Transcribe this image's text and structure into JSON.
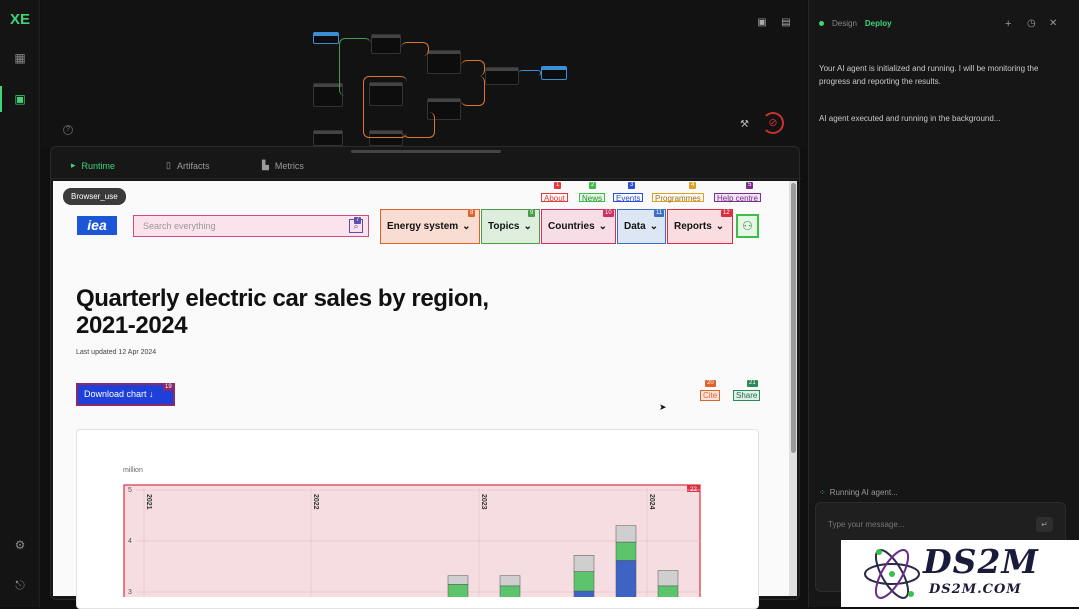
{
  "sidebar": {
    "logo": "XE",
    "icons": [
      "grid-icon",
      "board-icon",
      "settings-icon",
      "logout-icon"
    ]
  },
  "runtime_tabs": [
    {
      "label": "Runtime",
      "icon": "terminal-icon"
    },
    {
      "label": "Artifacts",
      "icon": "file-icon"
    },
    {
      "label": "Metrics",
      "icon": "chart-icon"
    }
  ],
  "browser": {
    "badge": "Browser_use",
    "top_links": [
      {
        "label": "About",
        "tag": "1",
        "color": "#e23b3b"
      },
      {
        "label": "News",
        "tag": "2",
        "color": "#3bbf4a"
      },
      {
        "label": "Events",
        "tag": "3",
        "color": "#2a4fd6"
      },
      {
        "label": "Programmes",
        "tag": "4",
        "color": "#e0a020"
      },
      {
        "label": "Help centre",
        "tag": "5",
        "color": "#7a2f8a"
      }
    ],
    "logo_text": "iea",
    "search_placeholder": "Search everything",
    "search_tag": "7",
    "nav": [
      {
        "label": "Energy system",
        "tag": "8",
        "bg": "#f9dcd2",
        "border": "#e0622c",
        "tagcolor": "#e0622c"
      },
      {
        "label": "Topics",
        "tag": "9",
        "bg": "#ddeedd",
        "border": "#4a9a4a",
        "tagcolor": "#4a9a4a"
      },
      {
        "label": "Countries",
        "tag": "10",
        "bg": "#f7dde5",
        "border": "#d03060",
        "tagcolor": "#d03060"
      },
      {
        "label": "Data",
        "tag": "11",
        "bg": "#dde6f5",
        "border": "#3a6fc4",
        "tagcolor": "#3a6fc4"
      },
      {
        "label": "Reports",
        "tag": "12",
        "bg": "#f9dde0",
        "border": "#d83040",
        "tagcolor": "#d83040"
      }
    ],
    "headline": "Quarterly electric car sales by region, 2021-2024",
    "updated": "Last updated 12 Apr 2024",
    "download_label": "Download chart ↓",
    "download_tag": "19",
    "cite_label": "Cite",
    "cite_tag": "20",
    "share_label": "Share",
    "share_tag": "21"
  },
  "chart_data": {
    "type": "bar",
    "stacked": true,
    "ylabel": "million",
    "ylim": [
      3,
      5
    ],
    "yticks": [
      3,
      4,
      5
    ],
    "year_labels": [
      "2021",
      "2022",
      "2023",
      "2024"
    ],
    "highlight_tag": "22",
    "series_colors": [
      "#3d63c4",
      "#5cc46a",
      "#cfcfcf"
    ],
    "bars": [
      {
        "total": 3.32,
        "segments": [
          0,
          3.15,
          3.32
        ]
      },
      {
        "total": 3.32,
        "segments": [
          0,
          3.12,
          3.32
        ]
      },
      {
        "total": 3.72,
        "segments": [
          3.02,
          3.4,
          3.72
        ]
      },
      {
        "total": 4.3,
        "segments": [
          3.62,
          3.98,
          4.3
        ]
      },
      {
        "total": 3.42,
        "segments": [
          0,
          3.12,
          3.42
        ]
      }
    ]
  },
  "agent_panel": {
    "tab_design": "Design",
    "tab_deploy": "Deploy",
    "message1": "Your AI agent is initialized and running. I will be monitoring the progress and reporting the results.",
    "message2": "AI agent executed and running in the background...",
    "status": "Running AI agent...",
    "input_placeholder": "Type your message..."
  },
  "watermark": {
    "title": "DS2M",
    "subtitle": "DS2M.COM"
  }
}
